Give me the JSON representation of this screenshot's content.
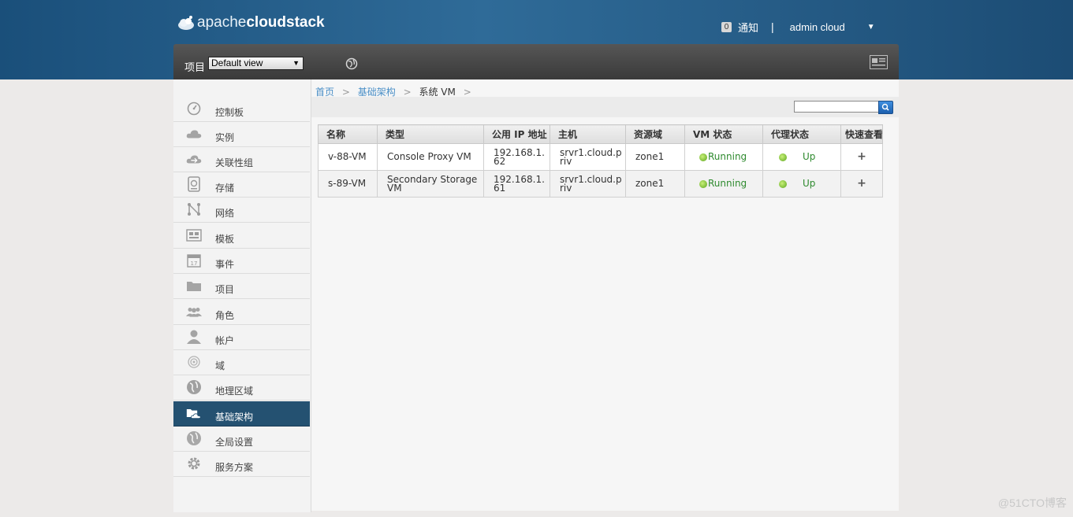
{
  "header": {
    "logo_light": "apache",
    "logo_bold": "cloudstack",
    "notification_count": "0",
    "notification_label": "通知",
    "separator": "|",
    "user_name": "admin cloud",
    "user_menu_arrow": "▼"
  },
  "toolbar": {
    "project_label": "项目",
    "project_selected": "Default view",
    "project_arrow": "▼"
  },
  "sidebar": {
    "items": [
      {
        "label": "控制板",
        "icon": "dashboard-icon"
      },
      {
        "label": "实例",
        "icon": "cloud-icon"
      },
      {
        "label": "关联性组",
        "icon": "affinity-icon"
      },
      {
        "label": "存储",
        "icon": "storage-icon"
      },
      {
        "label": "网络",
        "icon": "network-icon"
      },
      {
        "label": "模板",
        "icon": "template-icon"
      },
      {
        "label": "事件",
        "icon": "calendar-icon"
      },
      {
        "label": "项目",
        "icon": "folder-icon"
      },
      {
        "label": "角色",
        "icon": "roles-icon"
      },
      {
        "label": "帐户",
        "icon": "user-icon"
      },
      {
        "label": "域",
        "icon": "domain-icon"
      },
      {
        "label": "地理区域",
        "icon": "globe-icon"
      },
      {
        "label": "基础架构",
        "icon": "infrastructure-icon"
      },
      {
        "label": "全局设置",
        "icon": "settings-globe-icon"
      },
      {
        "label": "服务方案",
        "icon": "gear-icon"
      }
    ],
    "active_index": 12
  },
  "breadcrumb": {
    "home": "首页",
    "infrastructure": "基础架构",
    "current": "系统 VM",
    "sep": ">"
  },
  "search": {
    "placeholder": ""
  },
  "table": {
    "columns": [
      "名称",
      "类型",
      "公用 IP 地址",
      "主机",
      "资源域",
      "VM 状态",
      "代理状态",
      "快速查看"
    ],
    "rows": [
      {
        "name": "v-88-VM",
        "type": "Console Proxy VM",
        "ip": "192.168.1.62",
        "host": "srvr1.cloud.priv",
        "zone": "zone1",
        "vm_state": "Running",
        "agent_state": "Up",
        "quickview": "+"
      },
      {
        "name": "s-89-VM",
        "type": "Secondary Storage VM",
        "ip": "192.168.1.61",
        "host": "srvr1.cloud.priv",
        "zone": "zone1",
        "vm_state": "Running",
        "agent_state": "Up",
        "quickview": "+"
      }
    ]
  },
  "watermark": "@51CTO博客",
  "colors": {
    "header_blue": "#1a4f7a",
    "active_nav": "#245171",
    "link_blue": "#4a8fc7",
    "status_green": "#2e8a2e"
  }
}
